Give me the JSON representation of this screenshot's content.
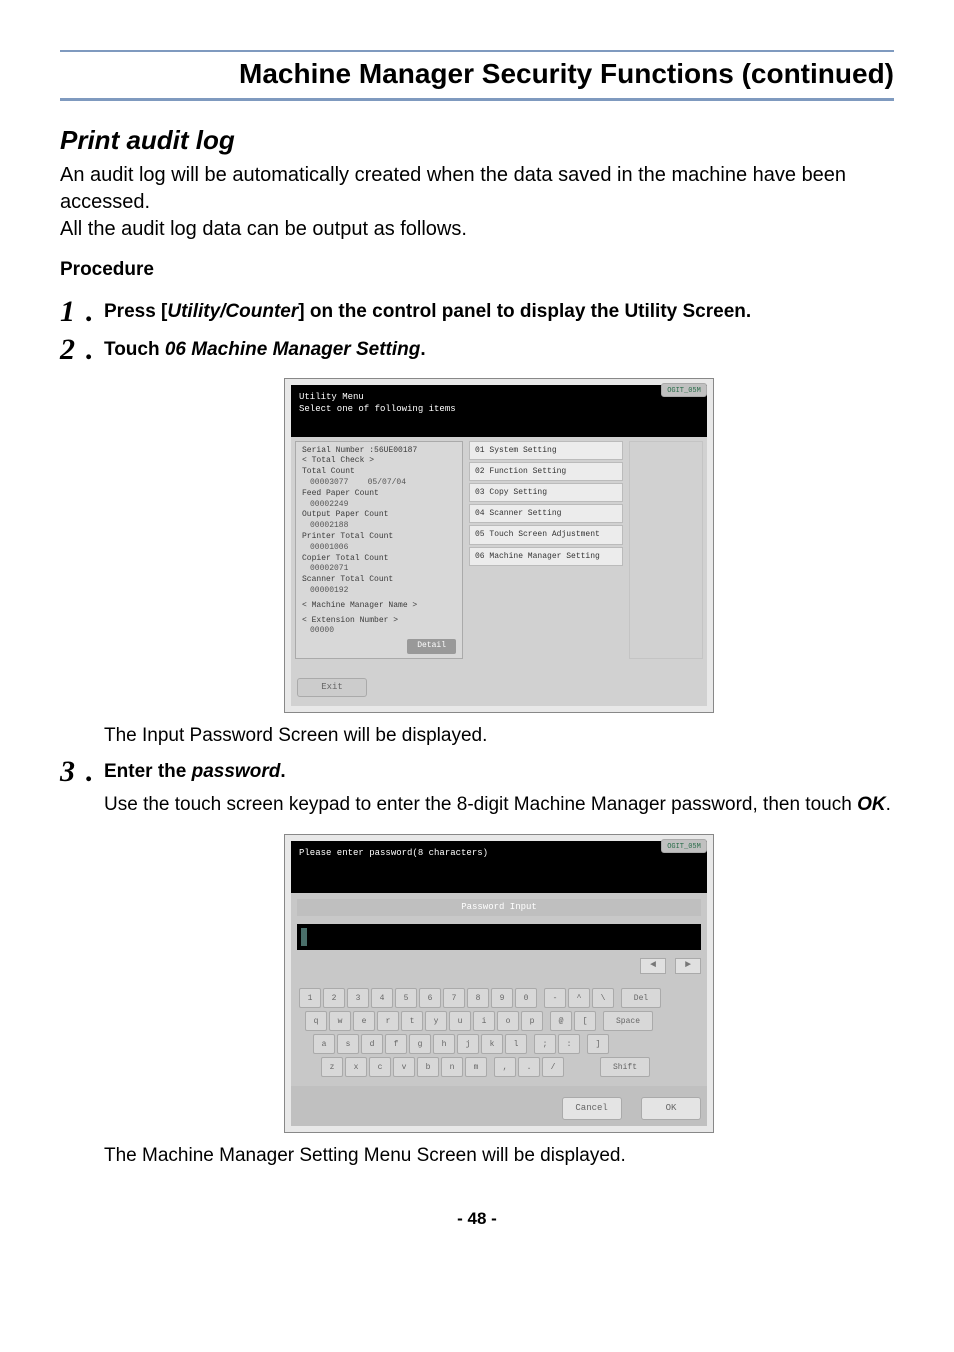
{
  "page": {
    "title": "Machine Manager Security Functions (continued)",
    "number": "- 48 -"
  },
  "section": {
    "heading": "Print audit log",
    "intro1": "An audit log will be automatically created when the data saved in the machine have been accessed.",
    "intro2": "All the audit log data can be output as follows.",
    "procedure_label": "Procedure"
  },
  "steps": {
    "s1": {
      "num": "1",
      "pre": "Press [",
      "em": "Utility/Counter",
      "post": "] on the control panel to display the Utility Screen."
    },
    "s2": {
      "num": "2",
      "pre": "Touch ",
      "em": "06 Machine Manager Setting",
      "post": ".",
      "desc": "The Input Password Screen will be displayed."
    },
    "s3": {
      "num": "3",
      "head_pre": "Enter the ",
      "head_em": "password",
      "head_post": ".",
      "desc_pre": "Use the touch screen keypad to enter the 8-digit Machine Manager password, then touch ",
      "desc_em": "OK",
      "desc_post": ".",
      "result": "The Machine Manager Setting Menu Screen will be displayed."
    }
  },
  "shot1": {
    "tab": "OGIT_05M",
    "header1": "Utility Menu",
    "header2": "Select one of following items",
    "left": {
      "serial_label": "Serial Number",
      "serial_value": ":56UE00187",
      "total_check": "< Total Check >",
      "total_count_label": "Total Count",
      "total_count_value": "00003077",
      "date": "05/07/04",
      "feed_label": "Feed Paper Count",
      "feed_value": "00002249",
      "output_label": "Output Paper Count",
      "output_value": "00002188",
      "printer_label": "Printer Total Count",
      "printer_value": "00001006",
      "copier_label": "Copier Total Count",
      "copier_value": "00002071",
      "scanner_label": "Scanner Total Count",
      "scanner_value": "00000192",
      "mgr_name": "< Machine Manager Name >",
      "ext_label": "< Extension Number >",
      "ext_value": "00000",
      "detail": "Detail"
    },
    "menu": {
      "m1": "01 System Setting",
      "m2": "02 Function Setting",
      "m3": "03 Copy Setting",
      "m4": "04 Scanner Setting",
      "m5": "05 Touch Screen Adjustment",
      "m6": "06 Machine Manager Setting"
    },
    "exit": "Exit"
  },
  "shot2": {
    "tab": "OGIT_05M",
    "prompt": "Please enter password(8 characters)",
    "title": "Password Input",
    "nav": {
      "left": "◄",
      "right": "►"
    },
    "row1": {
      "k1": "1",
      "k2": "2",
      "k3": "3",
      "k4": "4",
      "k5": "5",
      "k6": "6",
      "k7": "7",
      "k8": "8",
      "k9": "9",
      "k10": "0",
      "k11": "-",
      "k12": "^",
      "k13": "\\",
      "k14": "Del"
    },
    "row2": {
      "k1": "q",
      "k2": "w",
      "k3": "e",
      "k4": "r",
      "k5": "t",
      "k6": "y",
      "k7": "u",
      "k8": "i",
      "k9": "o",
      "k10": "p",
      "k11": "@",
      "k12": "[",
      "k13": "Space"
    },
    "row3": {
      "k1": "a",
      "k2": "s",
      "k3": "d",
      "k4": "f",
      "k5": "g",
      "k6": "h",
      "k7": "j",
      "k8": "k",
      "k9": "l",
      "k10": ";",
      "k11": ":",
      "k12": "]"
    },
    "row4": {
      "k1": "z",
      "k2": "x",
      "k3": "c",
      "k4": "v",
      "k5": "b",
      "k6": "n",
      "k7": "m",
      "k8": ",",
      "k9": ".",
      "k10": "/",
      "k11": "Shift"
    },
    "cancel": "Cancel",
    "ok": "OK"
  }
}
